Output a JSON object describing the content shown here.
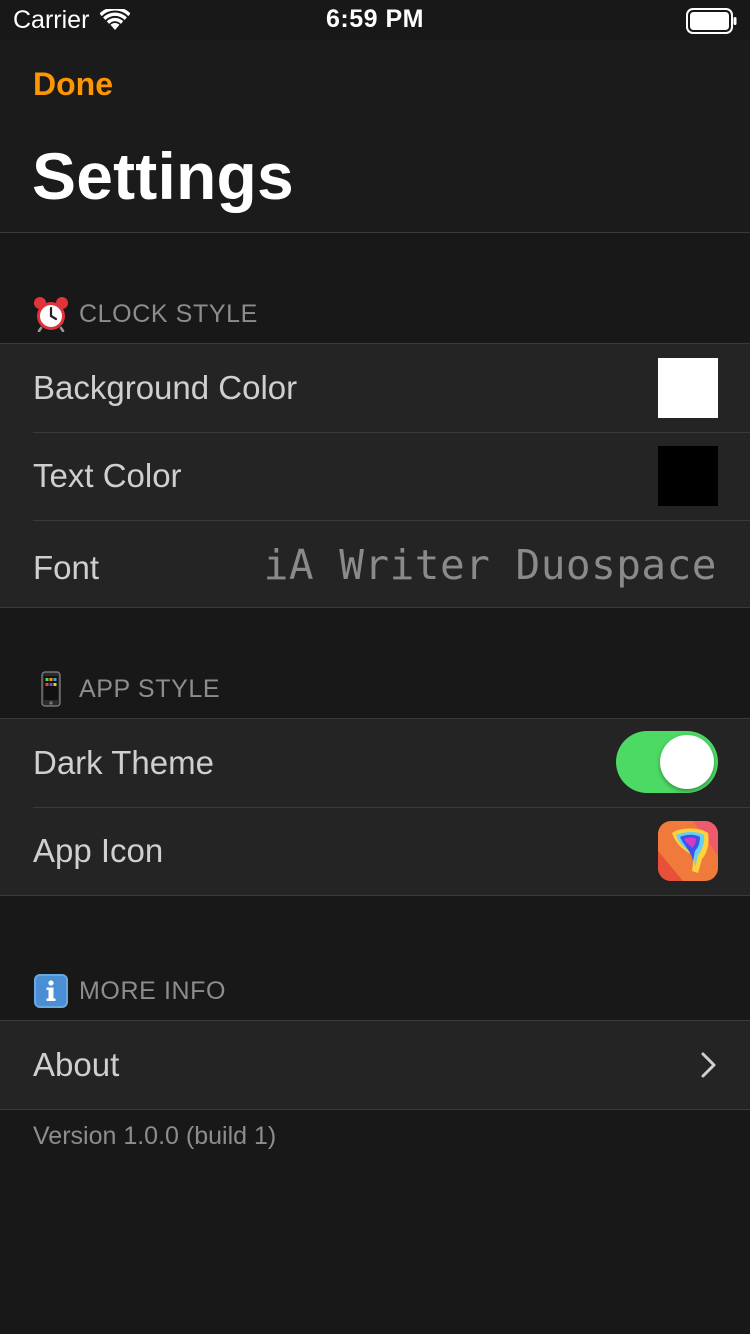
{
  "status_bar": {
    "carrier": "Carrier",
    "time": "6:59 PM",
    "wifi_icon": "wifi-icon",
    "battery_icon": "battery-icon"
  },
  "nav": {
    "done_label": "Done",
    "title": "Settings"
  },
  "sections": {
    "clock_style": {
      "icon": "alarm-clock-icon",
      "header": "CLOCK STYLE",
      "rows": {
        "background_color": {
          "label": "Background Color",
          "swatch_color": "#ffffff"
        },
        "text_color": {
          "label": "Text Color",
          "swatch_color": "#000000"
        },
        "font": {
          "label": "Font",
          "value": "iA Writer Duospace"
        }
      }
    },
    "app_style": {
      "icon": "mobile-phone-icon",
      "header": "APP STYLE",
      "rows": {
        "dark_theme": {
          "label": "Dark Theme",
          "enabled": true
        },
        "app_icon": {
          "label": "App Icon",
          "icon": "app-icon-preview"
        }
      }
    },
    "more_info": {
      "icon": "info-icon",
      "header": "MORE INFO",
      "rows": {
        "about": {
          "label": "About",
          "icon": "chevron-right-icon"
        }
      }
    }
  },
  "footer": {
    "version": "Version 1.0.0 (build 1)"
  },
  "colors": {
    "accent": "#ff9500",
    "toggle_on": "#4cd964",
    "background": "#181818",
    "cell_background": "#242424"
  }
}
